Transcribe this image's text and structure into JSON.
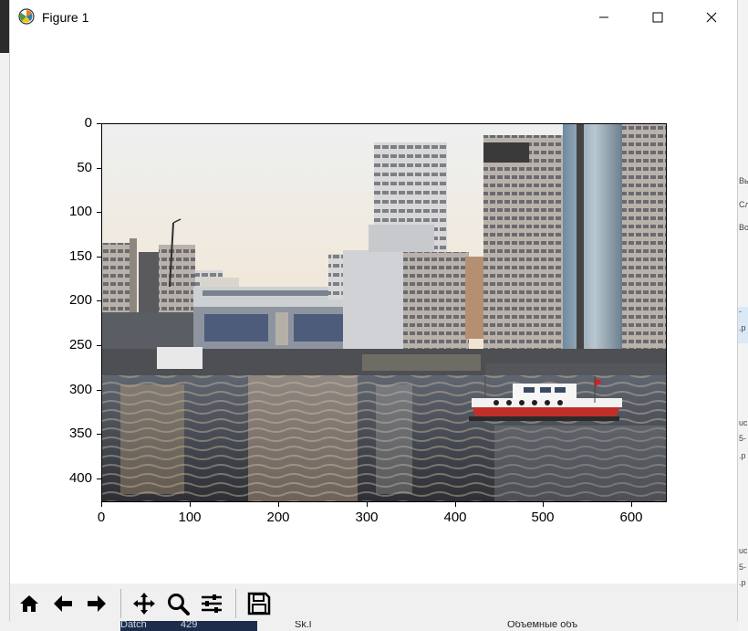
{
  "window": {
    "title": "Figure 1",
    "icons": {
      "app": "matplotlib-icon",
      "minimize": "minimize-icon",
      "maximize": "maximize-icon",
      "close": "close-icon"
    }
  },
  "plot": {
    "type": "image",
    "image_description_icon": "photo-canal-with-boat",
    "x_ticks": [
      "0",
      "100",
      "200",
      "300",
      "400",
      "500",
      "600"
    ],
    "y_ticks": [
      "0",
      "50",
      "100",
      "150",
      "200",
      "250",
      "300",
      "350",
      "400"
    ],
    "xlim": [
      0,
      640
    ],
    "ylim": [
      427,
      0
    ]
  },
  "toolbar": {
    "buttons": [
      {
        "name": "home-icon"
      },
      {
        "name": "back-icon"
      },
      {
        "name": "forward-icon"
      },
      {
        "name": "pan-icon"
      },
      {
        "name": "zoom-icon"
      },
      {
        "name": "configure-subplots-icon"
      },
      {
        "name": "save-icon"
      }
    ]
  },
  "background": {
    "right_fragments": [
      "Вы",
      "Сл",
      "Во",
      "-",
      ".p",
      "uc",
      "5-",
      ".p",
      "uc",
      "5-",
      ".p"
    ],
    "bottom_fragments": {
      "taskbar_left": "Datch",
      "taskbar_right": "429",
      "middle": "Sk.l",
      "right": "Объемные объ"
    }
  },
  "colors": {
    "accent_boat_red": "#c0302a",
    "sky": "#efe9de",
    "water": "#3b3e45"
  }
}
